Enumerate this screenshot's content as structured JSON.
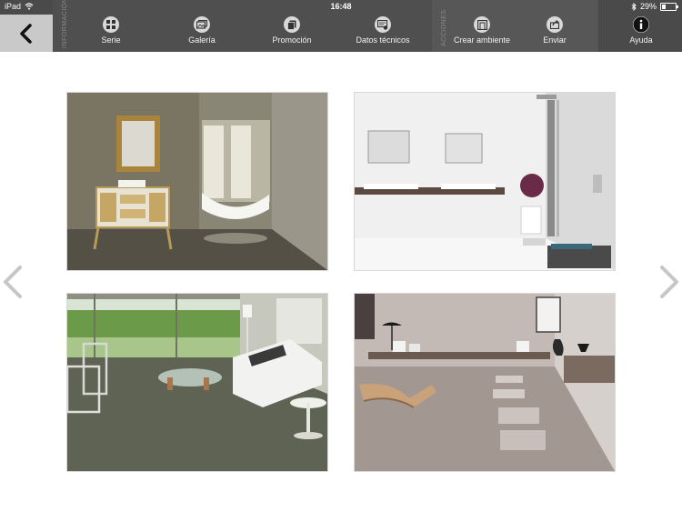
{
  "status": {
    "device": "iPad",
    "time": "16:48",
    "battery": "29%",
    "battery_level": 0.29
  },
  "toolbar": {
    "info_section_label": "INFORMACIÓN",
    "actions_section_label": "ACCIONES",
    "items": [
      {
        "label": "Serie"
      },
      {
        "label": "Galería"
      },
      {
        "label": "Promoción"
      },
      {
        "label": "Datos técnicos"
      },
      {
        "label": "Crear ambiente"
      },
      {
        "label": "Enviar"
      },
      {
        "label": "Ayuda"
      }
    ]
  },
  "colors": {
    "bar_bg": "#4a4a4a",
    "back_bg": "#c9c9c9",
    "icon_circle": "#d9d9d9",
    "arrow": "#c8c8c8"
  },
  "icons": {
    "back": "chevron-left-icon",
    "prev": "chevron-left-icon",
    "next": "chevron-right-icon",
    "serie": "grid-icon",
    "galeria": "gallery-icon",
    "promocion": "document-icon",
    "datos": "technical-data-icon",
    "crear": "create-room-icon",
    "enviar": "share-icon",
    "ayuda": "info-icon"
  }
}
